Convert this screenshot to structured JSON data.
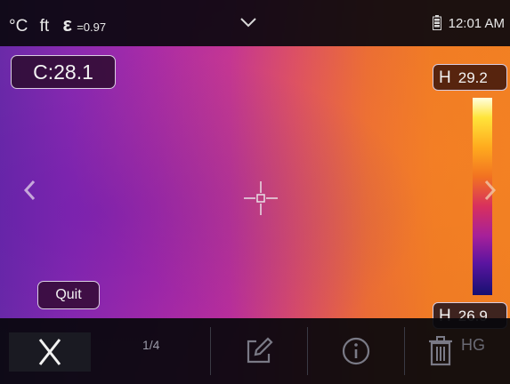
{
  "topbar": {
    "temp_unit": "°C",
    "distance_unit": "ft",
    "emissivity_symbol": "ε",
    "emissivity_value": "=0.97",
    "time": "12:01 AM"
  },
  "readouts": {
    "center": "C:28.1",
    "high_tag": "H",
    "high_value": "29.2",
    "low_tag": "H",
    "low_value": "26.9"
  },
  "buttons": {
    "quit": "Quit"
  },
  "toolbar": {
    "page_indicator": "1/4",
    "hg_label": "HG"
  },
  "icons": [
    "chevron-down-icon",
    "battery-icon",
    "chevron-left-icon",
    "chevron-right-icon",
    "crosshair-icon",
    "close-icon",
    "edit-icon",
    "info-icon",
    "trash-icon"
  ],
  "colors": {
    "palette_hot": "#ffffe0",
    "palette_cold": "#161070"
  }
}
